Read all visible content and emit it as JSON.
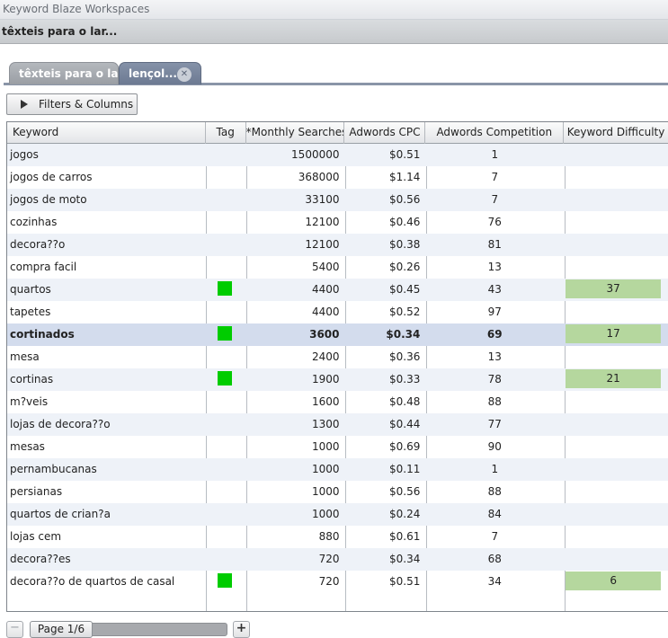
{
  "app": {
    "title": "Keyword Blaze Workspaces"
  },
  "workspace": {
    "title": "têxteis para o lar..."
  },
  "tabs": [
    {
      "label": "têxteis para o lar...",
      "active": false
    },
    {
      "label": "lençol...",
      "active": true,
      "close_icon": "close-icon"
    }
  ],
  "toolbar": {
    "filters_label": "Filters & Columns",
    "filters_icon": "play-icon"
  },
  "grid": {
    "columns": [
      "Keyword",
      "Tag",
      "*Monthly Searches",
      "Adwords CPC",
      "Adwords Competition",
      "Keyword Difficulty"
    ],
    "tag_color": "#00cc00",
    "difficulty_color": "#b5d79e",
    "selected_row_index": 8,
    "rows": [
      {
        "keyword": "jogos",
        "tagged": false,
        "searches": "1500000",
        "cpc": "$0.51",
        "competition": "1",
        "difficulty": ""
      },
      {
        "keyword": "jogos de carros",
        "tagged": false,
        "searches": "368000",
        "cpc": "$1.14",
        "competition": "7",
        "difficulty": ""
      },
      {
        "keyword": "jogos de moto",
        "tagged": false,
        "searches": "33100",
        "cpc": "$0.56",
        "competition": "7",
        "difficulty": ""
      },
      {
        "keyword": "cozinhas",
        "tagged": false,
        "searches": "12100",
        "cpc": "$0.46",
        "competition": "76",
        "difficulty": ""
      },
      {
        "keyword": "decora??o",
        "tagged": false,
        "searches": "12100",
        "cpc": "$0.38",
        "competition": "81",
        "difficulty": ""
      },
      {
        "keyword": "compra facil",
        "tagged": false,
        "searches": "5400",
        "cpc": "$0.26",
        "competition": "13",
        "difficulty": ""
      },
      {
        "keyword": "quartos",
        "tagged": true,
        "searches": "4400",
        "cpc": "$0.45",
        "competition": "43",
        "difficulty": "37"
      },
      {
        "keyword": "tapetes",
        "tagged": false,
        "searches": "4400",
        "cpc": "$0.52",
        "competition": "97",
        "difficulty": ""
      },
      {
        "keyword": "cortinados",
        "tagged": true,
        "searches": "3600",
        "cpc": "$0.34",
        "competition": "69",
        "difficulty": "17"
      },
      {
        "keyword": "mesa",
        "tagged": false,
        "searches": "2400",
        "cpc": "$0.36",
        "competition": "13",
        "difficulty": ""
      },
      {
        "keyword": "cortinas",
        "tagged": true,
        "searches": "1900",
        "cpc": "$0.33",
        "competition": "78",
        "difficulty": "21"
      },
      {
        "keyword": "m?veis",
        "tagged": false,
        "searches": "1600",
        "cpc": "$0.48",
        "competition": "88",
        "difficulty": ""
      },
      {
        "keyword": "lojas de decora??o",
        "tagged": false,
        "searches": "1300",
        "cpc": "$0.44",
        "competition": "77",
        "difficulty": ""
      },
      {
        "keyword": "mesas",
        "tagged": false,
        "searches": "1000",
        "cpc": "$0.69",
        "competition": "90",
        "difficulty": ""
      },
      {
        "keyword": "pernambucanas",
        "tagged": false,
        "searches": "1000",
        "cpc": "$0.11",
        "competition": "1",
        "difficulty": ""
      },
      {
        "keyword": "persianas",
        "tagged": false,
        "searches": "1000",
        "cpc": "$0.56",
        "competition": "88",
        "difficulty": ""
      },
      {
        "keyword": "quartos de crian?a",
        "tagged": false,
        "searches": "1000",
        "cpc": "$0.24",
        "competition": "84",
        "difficulty": ""
      },
      {
        "keyword": "lojas cem",
        "tagged": false,
        "searches": "880",
        "cpc": "$0.61",
        "competition": "7",
        "difficulty": ""
      },
      {
        "keyword": "decora??es",
        "tagged": false,
        "searches": "720",
        "cpc": "$0.34",
        "competition": "68",
        "difficulty": ""
      },
      {
        "keyword": "decora??o de quartos de casal",
        "tagged": true,
        "searches": "720",
        "cpc": "$0.51",
        "competition": "34",
        "difficulty": "6"
      }
    ]
  },
  "pager": {
    "label": "Page 1/6",
    "prev_icon": "minus-icon",
    "next_icon": "plus-icon"
  }
}
